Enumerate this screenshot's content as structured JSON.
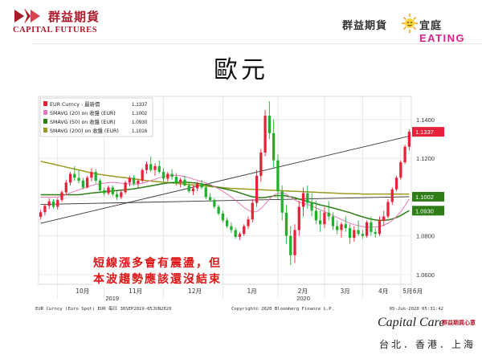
{
  "header": {
    "company_cn": "群益期貨",
    "company_en": "CAPITAL FUTURES",
    "slogan_left": "群益期貨",
    "slogan_right_cn": "宜庭",
    "slogan_right_en": "EATING"
  },
  "title": "歐元",
  "annotation": {
    "line1": "短線漲多會有震盪，但",
    "line2": "本波趨勢應該還沒結束"
  },
  "footer": {
    "logo": "Capital Care",
    "logo_small": "群益期貨心意",
    "cities": "台北．香港．上海"
  },
  "colors": {
    "brand_red": "#b0182a",
    "up_candle": "#e8213a",
    "down_candle": "#1fb02c",
    "sma20": "#e879b8",
    "sma50": "#2e7d16",
    "sma200": "#9a9a1e",
    "annotation_red": "#e01414"
  },
  "chart_data": {
    "type": "candlestick",
    "title": "",
    "legend": [
      {
        "label": "EUR Curncy - 最新價",
        "value": "1.1337"
      },
      {
        "label": "SMAVG (20) on 收盤 (EUR)",
        "value": "1.1002"
      },
      {
        "label": "SMAVG (50) on 收盤 (EUR)",
        "value": "1.0930"
      },
      {
        "label": "SMAVG (200) on 收盤 (EUR)",
        "value": "1.1016"
      }
    ],
    "last_price_labels": [
      {
        "value": "1.1337",
        "color": "#e8213a"
      },
      {
        "value": "1.1002",
        "color": "#2e7d16"
      },
      {
        "value": "1.0930",
        "color": "#2e7d16"
      }
    ],
    "ylim": [
      1.055,
      1.152
    ],
    "yticks": [
      "1.1400",
      "1.1200",
      "1.1000",
      "1.0800",
      "1.0600"
    ],
    "months": [
      "10月",
      "11月",
      "12月",
      "1月",
      "2月",
      "3月",
      "4月",
      "5月",
      "6月"
    ],
    "years": [
      "2019",
      "2020"
    ],
    "footer_left": "EUR Curncy (Euro Spot) EUR  每日 30SEP2019-05JUN2020",
    "footer_center": "Copyright© 2020 Bloomberg Finance L.P.",
    "footer_right": "05-Jun-2020 05:31:42",
    "ohlc": [
      [
        1.0898,
        1.0935,
        1.0885,
        1.0922
      ],
      [
        1.0922,
        1.0965,
        1.0905,
        1.0955
      ],
      [
        1.0955,
        1.0995,
        1.0938,
        1.0978
      ],
      [
        1.0978,
        1.099,
        1.094,
        1.095
      ],
      [
        1.095,
        1.0995,
        1.0935,
        1.0985
      ],
      [
        1.0985,
        1.1035,
        1.0975,
        1.1025
      ],
      [
        1.1025,
        1.109,
        1.101,
        1.1075
      ],
      [
        1.1075,
        1.113,
        1.106,
        1.112
      ],
      [
        1.112,
        1.116,
        1.1085,
        1.11
      ],
      [
        1.11,
        1.114,
        1.107,
        1.1085
      ],
      [
        1.1085,
        1.11,
        1.104,
        1.105
      ],
      [
        1.105,
        1.111,
        1.1045,
        1.11
      ],
      [
        1.11,
        1.115,
        1.108,
        1.113
      ],
      [
        1.113,
        1.1145,
        1.107,
        1.1085
      ],
      [
        1.1085,
        1.1095,
        1.102,
        1.1035
      ],
      [
        1.1035,
        1.105,
        1.1005,
        1.102
      ],
      [
        1.102,
        1.106,
        1.101,
        1.105
      ],
      [
        1.105,
        1.106,
        1.1005,
        1.1015
      ],
      [
        1.1015,
        1.103,
        1.0985,
        1.1
      ],
      [
        1.1,
        1.1035,
        1.099,
        1.1025
      ],
      [
        1.1025,
        1.1085,
        1.1015,
        1.1075
      ],
      [
        1.1075,
        1.111,
        1.1055,
        1.11
      ],
      [
        1.11,
        1.1115,
        1.106,
        1.107
      ],
      [
        1.107,
        1.1095,
        1.105,
        1.1085
      ],
      [
        1.1085,
        1.115,
        1.1075,
        1.114
      ],
      [
        1.114,
        1.1185,
        1.112,
        1.117
      ],
      [
        1.117,
        1.121,
        1.113,
        1.114
      ],
      [
        1.114,
        1.1175,
        1.111,
        1.116
      ],
      [
        1.116,
        1.119,
        1.112,
        1.113
      ],
      [
        1.113,
        1.115,
        1.108,
        1.1095
      ],
      [
        1.1095,
        1.113,
        1.108,
        1.112
      ],
      [
        1.112,
        1.1145,
        1.109,
        1.1105
      ],
      [
        1.1105,
        1.1125,
        1.106,
        1.1075
      ],
      [
        1.1075,
        1.11,
        1.105,
        1.109
      ],
      [
        1.109,
        1.111,
        1.1055,
        1.106
      ],
      [
        1.106,
        1.1075,
        1.102,
        1.103
      ],
      [
        1.103,
        1.106,
        1.101,
        1.1045
      ],
      [
        1.1045,
        1.108,
        1.103,
        1.107
      ],
      [
        1.107,
        1.109,
        1.104,
        1.105
      ],
      [
        1.105,
        1.106,
        1.099,
        1.1
      ],
      [
        1.1,
        1.102,
        1.0975,
        1.0985
      ],
      [
        1.0985,
        1.0995,
        1.094,
        1.095
      ],
      [
        1.095,
        1.096,
        1.0905,
        1.0915
      ],
      [
        1.0915,
        1.093,
        1.087,
        1.088
      ],
      [
        1.088,
        1.0895,
        1.084,
        1.085
      ],
      [
        1.085,
        1.087,
        1.0815,
        1.083
      ],
      [
        1.083,
        1.0845,
        1.0785,
        1.0795
      ],
      [
        1.0795,
        1.082,
        1.0778,
        1.081
      ],
      [
        1.081,
        1.086,
        1.08,
        1.085
      ],
      [
        1.085,
        1.09,
        1.0835,
        1.0885
      ],
      [
        1.0885,
        1.099,
        1.087,
        1.097
      ],
      [
        1.097,
        1.114,
        1.095,
        1.111
      ],
      [
        1.111,
        1.125,
        1.108,
        1.123
      ],
      [
        1.123,
        1.145,
        1.121,
        1.142
      ],
      [
        1.142,
        1.1495,
        1.13,
        1.133
      ],
      [
        1.133,
        1.14,
        1.115,
        1.119
      ],
      [
        1.119,
        1.122,
        1.099,
        1.103
      ],
      [
        1.103,
        1.106,
        1.088,
        1.092
      ],
      [
        1.092,
        1.096,
        1.076,
        1.08
      ],
      [
        1.08,
        1.085,
        1.065,
        1.07
      ],
      [
        1.07,
        1.086,
        1.066,
        1.083
      ],
      [
        1.083,
        1.098,
        1.08,
        1.095
      ],
      [
        1.095,
        1.105,
        1.09,
        1.102
      ],
      [
        1.102,
        1.106,
        1.094,
        1.097
      ],
      [
        1.097,
        1.102,
        1.09,
        1.093
      ],
      [
        1.093,
        1.098,
        1.086,
        1.088
      ],
      [
        1.088,
        1.093,
        1.082,
        1.086
      ],
      [
        1.086,
        1.095,
        1.084,
        1.092
      ],
      [
        1.092,
        1.098,
        1.088,
        1.09
      ],
      [
        1.09,
        1.092,
        1.083,
        1.085
      ],
      [
        1.085,
        1.088,
        1.081,
        1.083
      ],
      [
        1.083,
        1.087,
        1.079,
        1.086
      ],
      [
        1.086,
        1.09,
        1.082,
        1.084
      ],
      [
        1.084,
        1.086,
        1.076,
        1.079
      ],
      [
        1.079,
        1.085,
        1.077,
        1.083
      ],
      [
        1.083,
        1.088,
        1.08,
        1.081
      ],
      [
        1.081,
        1.083,
        1.0785,
        1.08
      ],
      [
        1.08,
        1.088,
        1.079,
        1.087
      ],
      [
        1.087,
        1.09,
        1.08,
        1.082
      ],
      [
        1.082,
        1.084,
        1.079,
        1.081
      ],
      [
        1.081,
        1.09,
        1.08,
        1.088
      ],
      [
        1.088,
        1.093,
        1.085,
        1.09
      ],
      [
        1.09,
        1.099,
        1.089,
        1.0975
      ],
      [
        1.0975,
        1.105,
        1.096,
        1.104
      ],
      [
        1.104,
        1.111,
        1.103,
        1.11
      ],
      [
        1.11,
        1.119,
        1.109,
        1.118
      ],
      [
        1.118,
        1.127,
        1.117,
        1.126
      ],
      [
        1.126,
        1.135,
        1.124,
        1.1337
      ]
    ],
    "sma20": [
      1.1,
      1.1,
      1.1,
      1.1,
      1.1,
      1.1005,
      1.1012,
      1.1022,
      1.103,
      1.1038,
      1.1045,
      1.1052,
      1.106,
      1.1066,
      1.107,
      1.1072,
      1.1075,
      1.1076,
      1.1075,
      1.1072,
      1.107,
      1.1068,
      1.1067,
      1.1068,
      1.1072,
      1.1078,
      1.1085,
      1.1092,
      1.11,
      1.1106,
      1.111,
      1.1113,
      1.1112,
      1.111,
      1.1106,
      1.11,
      1.1093,
      1.1087,
      1.108,
      1.1073,
      1.1065,
      1.1055,
      1.1043,
      1.103,
      1.1015,
      1.1,
      1.0983,
      1.0965,
      1.0948,
      1.0932,
      1.0923,
      1.0925,
      1.094,
      1.0965,
      1.099,
      1.101,
      1.102,
      1.1022,
      1.1015,
      1.1,
      1.0985,
      1.0975,
      1.0968,
      1.0962,
      1.0955,
      1.0945,
      1.0935,
      1.0925,
      1.0915,
      1.0905,
      1.0895,
      1.0885,
      1.0875,
      1.0865,
      1.0858,
      1.0853,
      1.0848,
      1.0845,
      1.0845,
      1.0845,
      1.0848,
      1.0855,
      1.0865,
      1.088,
      1.09,
      1.0925,
      1.0955,
      1.099
    ],
    "sma50": [
      1.1012,
      1.1012,
      1.1012,
      1.1012,
      1.1012,
      1.1012,
      1.1012,
      1.1012,
      1.1012,
      1.1012,
      1.1015,
      1.1018,
      1.1021,
      1.1023,
      1.1025,
      1.1028,
      1.103,
      1.1032,
      1.1034,
      1.1036,
      1.1038,
      1.104,
      1.1043,
      1.1046,
      1.105,
      1.1054,
      1.1058,
      1.1062,
      1.1066,
      1.107,
      1.1073,
      1.1075,
      1.1076,
      1.1077,
      1.1077,
      1.1076,
      1.1074,
      1.1071,
      1.1068,
      1.1064,
      1.106,
      1.1055,
      1.105,
      1.1045,
      1.104,
      1.1035,
      1.1029,
      1.1022,
      1.1015,
      1.1008,
      1.1002,
      1.0998,
      1.0996,
      1.0998,
      1.1002,
      1.1006,
      1.1008,
      1.1008,
      1.1006,
      1.1002,
      1.0996,
      1.099,
      1.0984,
      1.0978,
      1.0972,
      1.0966,
      1.096,
      1.0955,
      1.095,
      1.0944,
      1.0938,
      1.0932,
      1.0926,
      1.092,
      1.0912,
      1.0905,
      1.0898,
      1.0892,
      1.0886,
      1.0882,
      1.088,
      1.088,
      1.0882,
      1.0887,
      1.0895,
      1.0905,
      1.0918,
      1.093
    ],
    "sma200": [
      1.1185,
      1.118,
      1.1175,
      1.117,
      1.1165,
      1.116,
      1.1155,
      1.115,
      1.1145,
      1.114,
      1.1135,
      1.113,
      1.1125,
      1.112,
      1.1117,
      1.1114,
      1.1111,
      1.1108,
      1.1105,
      1.1102,
      1.11,
      1.1097,
      1.1094,
      1.1091,
      1.1088,
      1.1085,
      1.1083,
      1.1081,
      1.1079,
      1.1077,
      1.1075,
      1.1073,
      1.1071,
      1.1069,
      1.1067,
      1.1065,
      1.1063,
      1.1061,
      1.1059,
      1.1057,
      1.1055,
      1.1053,
      1.1051,
      1.1049,
      1.1047,
      1.1045,
      1.1044,
      1.1043,
      1.1042,
      1.1041,
      1.104,
      1.1039,
      1.1038,
      1.1037,
      1.1036,
      1.1035,
      1.1034,
      1.1033,
      1.1032,
      1.1031,
      1.103,
      1.1029,
      1.1028,
      1.1027,
      1.1026,
      1.1025,
      1.1024,
      1.1023,
      1.1022,
      1.1021,
      1.102,
      1.1019,
      1.1018,
      1.1018,
      1.1017,
      1.1017,
      1.1016,
      1.1016,
      1.1016,
      1.1016,
      1.1016,
      1.1016,
      1.1016,
      1.1016,
      1.1016,
      1.1016,
      1.1016,
      1.1016
    ],
    "trendlines": [
      {
        "from": [
          0,
          1.0865
        ],
        "to": [
          87,
          1.1315
        ],
        "color": "#333333"
      },
      {
        "from": [
          0,
          1.0962
        ],
        "to": [
          87,
          1.1002
        ],
        "color": "#333333"
      }
    ]
  }
}
